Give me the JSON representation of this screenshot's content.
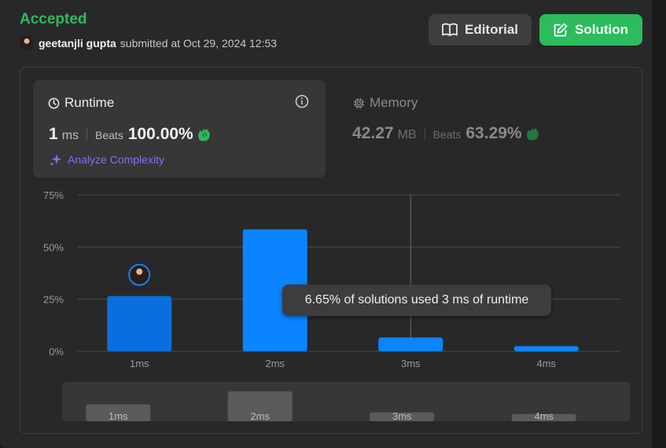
{
  "status": "Accepted",
  "submission": {
    "user": "geetanjli gupta",
    "submitted_text": "submitted at Oct 29, 2024 12:53"
  },
  "buttons": {
    "editorial": "Editorial",
    "solution": "Solution"
  },
  "runtime": {
    "title": "Runtime",
    "value": "1",
    "unit": "ms",
    "beats_label": "Beats",
    "beats_value": "100.00%",
    "analyze": "Analyze Complexity"
  },
  "memory": {
    "title": "Memory",
    "value": "42.27",
    "unit": "MB",
    "beats_label": "Beats",
    "beats_value": "63.29%"
  },
  "tooltip": "6.65% of solutions used 3 ms of runtime",
  "colors": {
    "accepted": "#2cbb5d",
    "bar": "#0a84ff",
    "bar_own": "#0a6fde",
    "analyze": "#8c6cf2",
    "clap": "#2cbb5d"
  },
  "chart_data": {
    "type": "bar",
    "categories": [
      "1ms",
      "2ms",
      "3ms",
      "4ms"
    ],
    "values": [
      26.5,
      58.5,
      6.65,
      2.5
    ],
    "y_ticks": [
      "0%",
      "25%",
      "50%",
      "75%"
    ],
    "ylim": [
      0,
      75
    ],
    "grid": true,
    "highlight_category": "1ms",
    "hover_category": "3ms"
  },
  "mini_chart": {
    "labels": [
      "1ms",
      "2ms",
      "3ms",
      "4ms"
    ],
    "values": [
      26.5,
      58.5,
      6.65,
      2.5
    ]
  }
}
